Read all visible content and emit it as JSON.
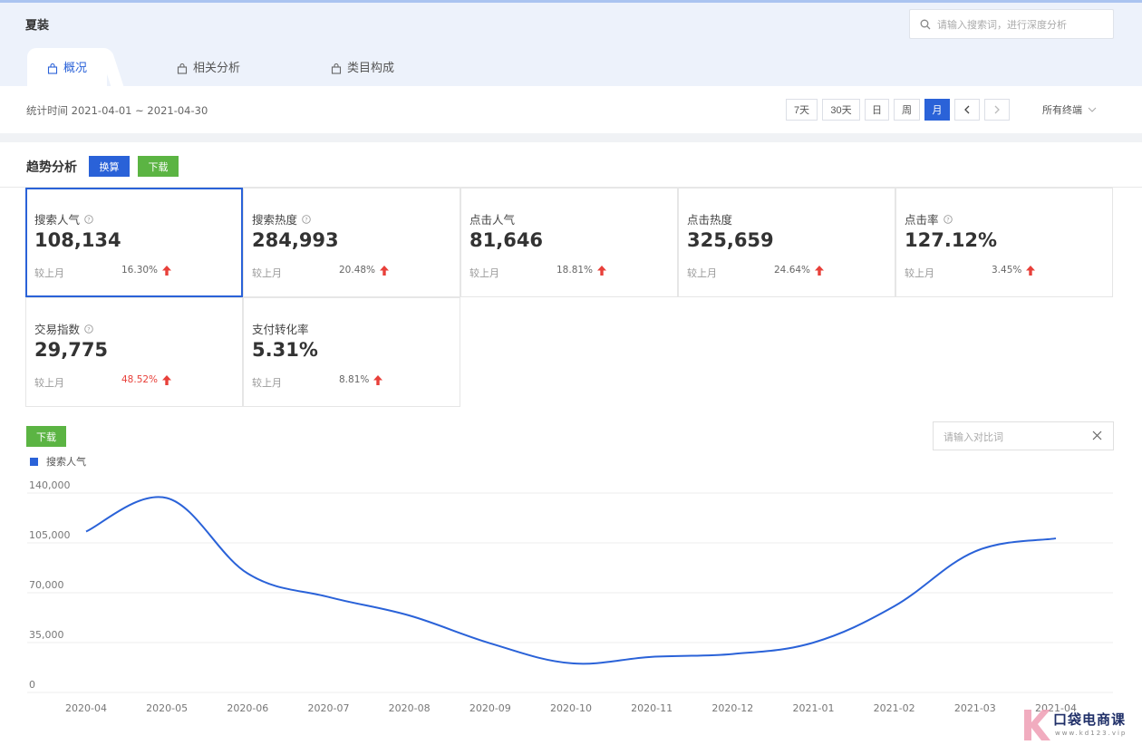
{
  "header": {
    "category": "夏装",
    "search_placeholder": "请输入搜索词，进行深度分析"
  },
  "tabs": [
    {
      "label": "概况",
      "active": true
    },
    {
      "label": "相关分析",
      "active": false
    },
    {
      "label": "类目构成",
      "active": false
    }
  ],
  "toolbar": {
    "stat_time": "统计时间 2021-04-01 ~ 2021-04-30",
    "periods": [
      "7天",
      "30天",
      "日",
      "周",
      "月"
    ],
    "active_period": "月",
    "terminal": "所有终端"
  },
  "trend": {
    "title": "趋势分析",
    "convert_label": "换算",
    "download_label": "下载"
  },
  "metrics": [
    {
      "label": "搜索人气",
      "help": true,
      "value": "108,134",
      "compare": "较上月",
      "pct": "16.30%",
      "pct_red": false,
      "selected": true
    },
    {
      "label": "搜索热度",
      "help": true,
      "value": "284,993",
      "compare": "较上月",
      "pct": "20.48%",
      "pct_red": false
    },
    {
      "label": "点击人气",
      "help": false,
      "value": "81,646",
      "compare": "较上月",
      "pct": "18.81%",
      "pct_red": false
    },
    {
      "label": "点击热度",
      "help": false,
      "value": "325,659",
      "compare": "较上月",
      "pct": "24.64%",
      "pct_red": false
    },
    {
      "label": "点击率",
      "help": true,
      "value": "127.12%",
      "compare": "较上月",
      "pct": "3.45%",
      "pct_red": false
    },
    {
      "label": "交易指数",
      "help": true,
      "value": "29,775",
      "compare": "较上月",
      "pct": "48.52%",
      "pct_red": true
    },
    {
      "label": "支付转化率",
      "help": false,
      "value": "5.31%",
      "compare": "较上月",
      "pct": "8.81%",
      "pct_red": false
    }
  ],
  "chart_panel": {
    "download_label": "下载",
    "compare_placeholder": "请输入对比词"
  },
  "colors": {
    "accent": "#2a62d8",
    "green": "#5bb443",
    "up_arrow": "#e8403a"
  },
  "chart_data": {
    "type": "line",
    "categories": [
      "2020-04",
      "2020-05",
      "2020-06",
      "2020-07",
      "2020-08",
      "2020-09",
      "2020-10",
      "2020-11",
      "2020-12",
      "2021-01",
      "2021-02",
      "2021-03",
      "2021-04"
    ],
    "series": [
      {
        "name": "搜索人气",
        "values": [
          113000,
          136500,
          83500,
          67000,
          54000,
          34500,
          20500,
          25000,
          27000,
          35000,
          60500,
          99000,
          108134
        ]
      }
    ],
    "ylim": [
      0,
      140000
    ],
    "yticks": [
      "140,000",
      "105,000",
      "70,000",
      "35,000",
      "0"
    ],
    "ytick_values": [
      140000,
      105000,
      70000,
      35000,
      0
    ],
    "grid": true,
    "legend": "top-left"
  },
  "watermark": {
    "text": "口袋电商课",
    "sub": "www.kd123.vip"
  }
}
